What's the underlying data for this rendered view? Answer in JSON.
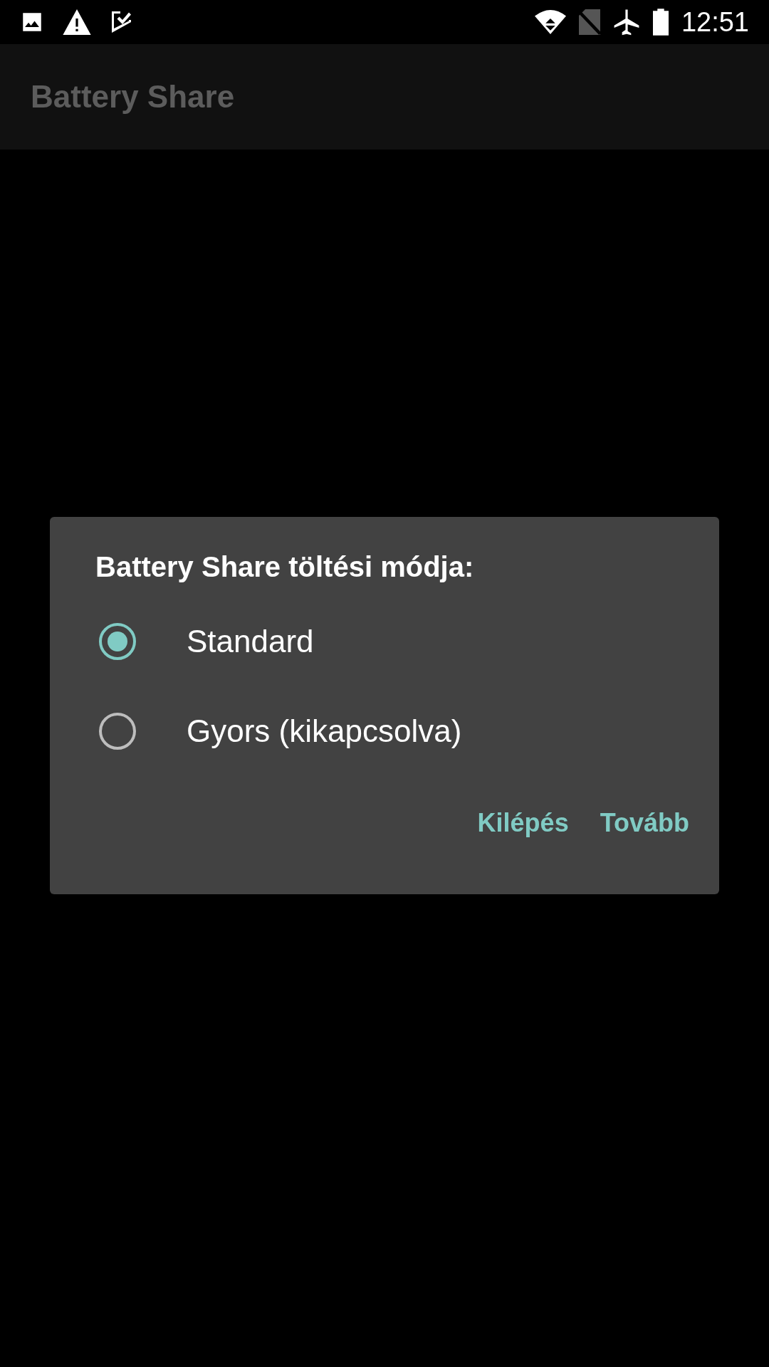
{
  "status_bar": {
    "time": "12:51"
  },
  "app_bar": {
    "title": "Battery Share"
  },
  "dialog": {
    "title": "Battery Share töltési módja:",
    "options": [
      {
        "label": "Standard",
        "selected": true
      },
      {
        "label": "Gyors (kikapcsolva)",
        "selected": false
      }
    ],
    "buttons": [
      "Kilépés",
      "Tovább"
    ]
  }
}
